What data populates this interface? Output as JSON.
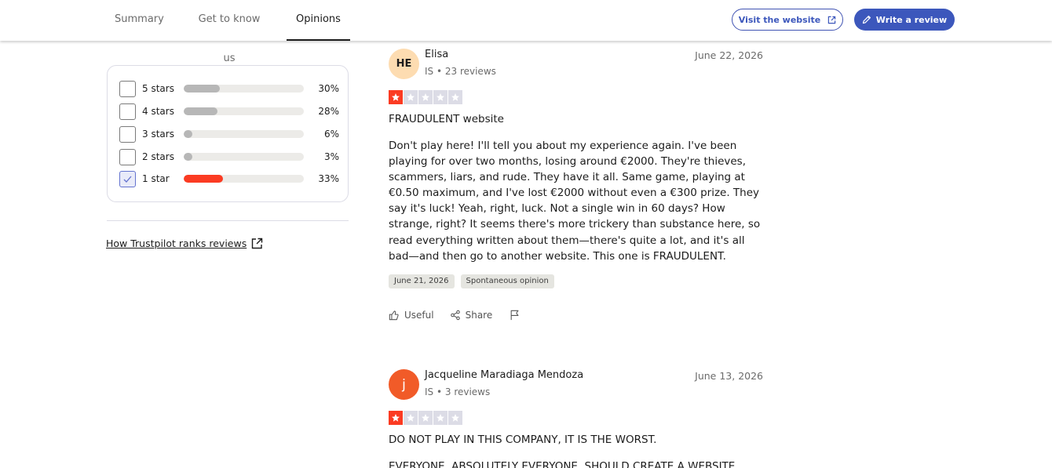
{
  "nav": {
    "tabs": [
      {
        "label": "Summary"
      },
      {
        "label": "Get to know us"
      },
      {
        "label": "Opinions"
      }
    ],
    "visit_label": "Visit the website",
    "write_label": "Write a review"
  },
  "filter": {
    "rows": [
      {
        "label": "5 stars",
        "percent": "30%",
        "value": 30,
        "checked": false
      },
      {
        "label": "4 stars",
        "percent": "28%",
        "value": 28,
        "checked": false
      },
      {
        "label": "3 stars",
        "percent": "6%",
        "value": 6,
        "checked": false
      },
      {
        "label": "2 stars",
        "percent": "3%",
        "value": 3,
        "checked": false
      },
      {
        "label": "1 star",
        "percent": "33%",
        "value": 33,
        "checked": true
      }
    ],
    "how_link": "How Trustpilot ranks reviews"
  },
  "reviews": [
    {
      "initials": "HE",
      "name": "Elisa",
      "meta": "IS • 23 reviews",
      "date": "June 22, 2026",
      "rating": 1,
      "title": "FRAUDULENT website",
      "body": "Don't play here! I'll tell you about my experience again. I've been playing for over two months, losing around €2000. They're thieves, scammers, liars, and rude. They have it all. Same game, playing at €0.50 maximum, and I've lost €2000 without even a €300 prize. They say it's luck! Yeah, right, luck. Not a single win in 60 days? How strange, right? It seems there's more trickery than substance here, so read everything written about them—there's quite a lot, and it's all bad—and then go to another website. This one is FRAUDULENT.",
      "tags": [
        "June 21, 2026",
        "Spontaneous opinion"
      ],
      "useful_label": "Useful",
      "share_label": "Share"
    },
    {
      "initials": "j",
      "name": "Jacqueline Maradiaga Mendoza",
      "meta": "IS • 3 reviews",
      "date": "June 13, 2026",
      "rating": 1,
      "title": "DO NOT PLAY IN THIS COMPANY, IT IS THE WORST.",
      "body": "EVERYONE, ABSOLUTELY EVERYONE, SHOULD CREATE A WEBSITE"
    }
  ],
  "colors": {
    "accent": "#3c57bc",
    "star_red": "#fb3b22",
    "star_empty": "#dcdce6",
    "avatar_peach": "#fddcb1",
    "avatar_orange": "#f15b28"
  }
}
